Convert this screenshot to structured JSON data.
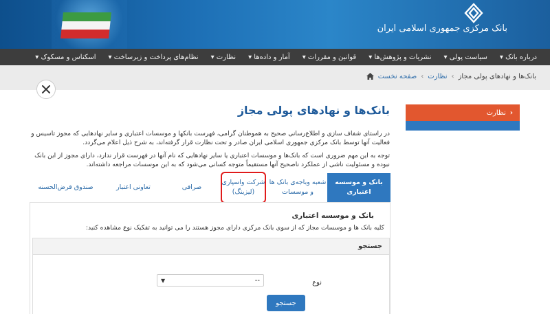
{
  "header": {
    "logo_text": "بانک مرکزی جمهوری اسلامی ایران"
  },
  "nav": {
    "items": [
      {
        "label": "درباره بانک ▾"
      },
      {
        "label": "سیاست پولی ▾"
      },
      {
        "label": "نشریات و پژوهش‌ها ▾"
      },
      {
        "label": "قوانین و مقررات ▾"
      },
      {
        "label": "آمار و داده‌ها ▾"
      },
      {
        "label": "نظارت ▾"
      },
      {
        "label": "نظام‌های پرداخت و زیرساخت ▾"
      },
      {
        "label": "اسکناس و مسکوک ▾"
      }
    ]
  },
  "breadcrumb": {
    "home": "صفحه نخست",
    "sep": "›",
    "parent": "نظارت",
    "current": "بانک‌ها و نهادهای پولی مجاز"
  },
  "sidebar": {
    "button_label": "نظارت",
    "chevron": "‹"
  },
  "main": {
    "title": "بانک‌ها و نهادهای پولی مجاز",
    "para1": "در راستای شفاف سازی و اطلاع‌رسانی صحیح به هموطنان گرامی، فهرست بانکها و موسسات اعتباری و سایر نهادهایی که مجوز تاسیس و فعالیت آنها توسط بانک مرکزی جمهوری اسلامی ایران صادر و تحت نظارت قرار گرفته‌اند، به شرح ذیل اعلام می‌گردد.",
    "para2": "توجه به این مهم ضروری است که بانک‌ها و موسسات اعتباری یا سایر نهادهایی که نام آنها در فهرست قرار ندارد، دارای مجوز از این بانک نبوده و مسئولیت ناشی از عملکرد ناصحیح آنها مستقیماً متوجه کسانی می‌شود که به این موسسات مراجعه داشته‌اند."
  },
  "tabs": [
    {
      "label": "بانک و موسسه اعتباری"
    },
    {
      "label": "شعبه وباجه‌ی بانک ها و موسسات"
    },
    {
      "label": "شرکت واسپاری (لیزینگ)"
    },
    {
      "label": "صرافی"
    },
    {
      "label": "تعاونی اعتبار"
    },
    {
      "label": "صندوق قرض‌الحسنه"
    }
  ],
  "panel": {
    "title": "بانک و موسسه اعتباری",
    "desc": "کلیه بانک ها و موسسات مجاز که از سوی بانک مرکزی دارای مجوز هستند را می توانید به تفکیک نوع مشاهده کنید:",
    "search_heading": "جستجو",
    "type_label": "نوع",
    "type_value": "--",
    "search_button": "جستجو"
  },
  "colors": {
    "accent": "#2f78bf",
    "nav_bg": "#3d3d3d",
    "sidebar_btn": "#e2572f",
    "highlight_ring": "#e01b1b"
  }
}
